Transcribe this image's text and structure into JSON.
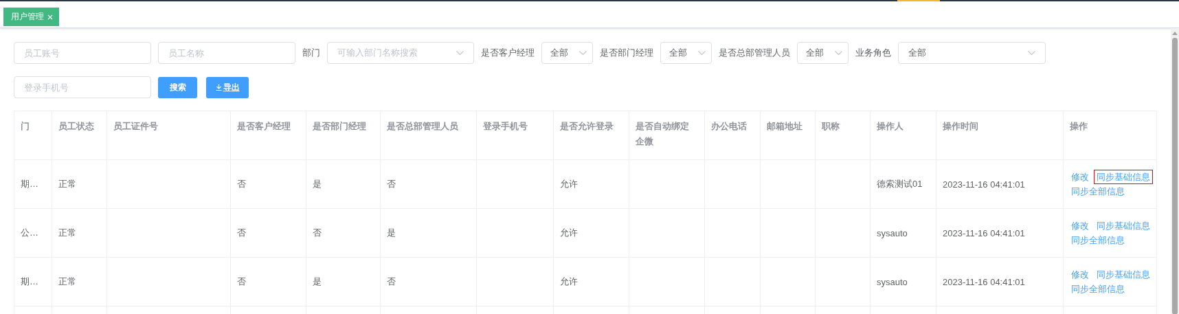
{
  "tabs": [
    {
      "label": "用户管理",
      "selected": true
    }
  ],
  "filters": [
    [
      {
        "kind": "input",
        "placeholder": "员工账号"
      },
      {
        "kind": "input",
        "placeholder": "员工名称"
      },
      {
        "kind": "combo",
        "label": "部门",
        "placeholder": "可输入部门名称搜索"
      },
      {
        "kind": "select",
        "label": "是否客户经理",
        "value": "全部"
      },
      {
        "kind": "select",
        "label": "是否部门经理",
        "value": "全部"
      },
      {
        "kind": "select",
        "label": "是否总部管理人员",
        "value": "全部"
      },
      {
        "kind": "combo",
        "label": "业务角色",
        "value": "全部"
      }
    ],
    [
      {
        "kind": "input",
        "placeholder": "登录手机号"
      },
      {
        "kind": "search",
        "label": "搜索"
      },
      {
        "kind": "export",
        "label": "导出"
      }
    ]
  ],
  "table": {
    "columns": [
      "门",
      "员工状态",
      "员工证件号",
      "是否客户经理",
      "是否部门经理",
      "是否总部管理人员",
      "登录手机号",
      "是否允许登录",
      "是否自动绑定企微",
      "办公电话",
      "邮箱地址",
      "职称",
      "操作人",
      "操作时间",
      "操作"
    ],
    "rows": [
      {
        "cells": [
          "期…",
          "正常",
          null,
          "否",
          "是",
          "否",
          null,
          "允许",
          null,
          null,
          null,
          null,
          "德索测试01",
          "2023-11-16 04:41:01"
        ],
        "actions": [
          {
            "label": "修改",
            "highlighted": false
          },
          {
            "label": "同步基础信息",
            "highlighted": true
          },
          {
            "label": "同步全部信息",
            "highlighted": false
          }
        ]
      },
      {
        "cells": [
          "公…",
          "正常",
          null,
          "否",
          "否",
          "是",
          null,
          "允许",
          null,
          null,
          null,
          null,
          "sysauto",
          "2023-11-16 04:41:01"
        ],
        "actions": [
          {
            "label": "修改",
            "highlighted": false
          },
          {
            "label": "同步基础信息",
            "highlighted": false
          },
          {
            "label": "同步全部信息",
            "highlighted": false
          }
        ]
      },
      {
        "cells": [
          "期…",
          "正常",
          null,
          "否",
          "是",
          "否",
          null,
          "允许",
          null,
          null,
          null,
          null,
          "sysauto",
          "2023-11-16 04:41:01"
        ],
        "actions": [
          {
            "label": "修改",
            "highlighted": false
          },
          {
            "label": "同步基础信息",
            "highlighted": false
          },
          {
            "label": "同步全部信息",
            "highlighted": false
          }
        ]
      }
    ]
  }
}
